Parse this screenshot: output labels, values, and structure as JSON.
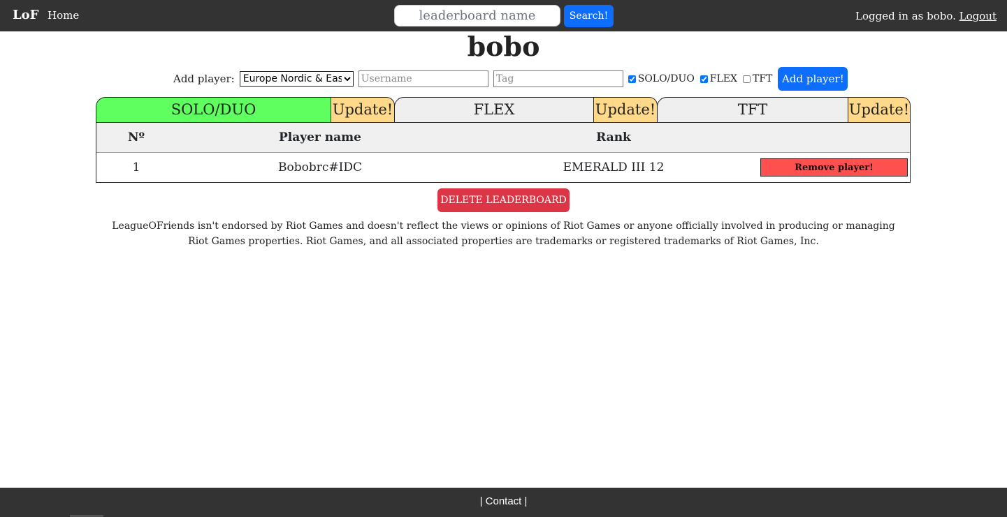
{
  "navbar": {
    "brand": "LoF",
    "home": "Home",
    "search_placeholder": "leaderboard name",
    "search_button": "Search!",
    "logged_in_text": "Logged in as bobo.",
    "logout": "Logout"
  },
  "page": {
    "title": "bobo"
  },
  "add_player": {
    "label": "Add player:",
    "region_selected": "Europe Nordic & East",
    "username_placeholder": "Username",
    "tag_placeholder": "Tag",
    "queues": [
      {
        "label": "SOLO/DUO",
        "checked": true
      },
      {
        "label": "FLEX",
        "checked": true
      },
      {
        "label": "TFT",
        "checked": false
      }
    ],
    "button": "Add player!"
  },
  "tabs": [
    {
      "label": "SOLO/DUO",
      "update": "Update!",
      "active": true
    },
    {
      "label": "FLEX",
      "update": "Update!",
      "active": false
    },
    {
      "label": "TFT",
      "update": "Update!",
      "active": false
    }
  ],
  "table": {
    "headers": [
      "Nº",
      "Player name",
      "Rank"
    ],
    "rows": [
      {
        "num": "1",
        "name": "Bobobrc#IDC",
        "rank": "EMERALD III 12",
        "action": "Remove player!"
      }
    ]
  },
  "delete_button": "DELETE LEADERBOARD",
  "disclaimer": "LeagueOFriends isn't endorsed by Riot Games and doesn't reflect the views or opinions of Riot Games or anyone officially involved in producing or managing Riot Games properties. Riot Games, and all associated properties are trademarks or registered trademarks of Riot Games, Inc.",
  "footer": {
    "contact": "| Contact |"
  },
  "colors": {
    "navbar_bg": "#333333",
    "primary": "#0d6efd",
    "active_tab": "#5eff5e",
    "update_bg": "#ffd98a",
    "remove_bg": "#ff5050",
    "danger": "#dc3545"
  }
}
